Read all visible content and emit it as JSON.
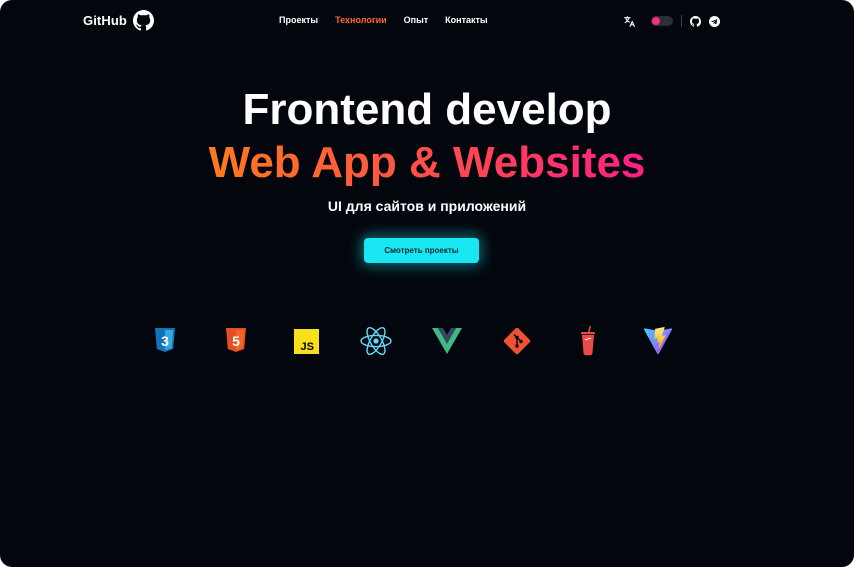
{
  "header": {
    "logo_text": "GitHub",
    "nav": [
      {
        "label": "Проекты",
        "active": false
      },
      {
        "label": "Технологии",
        "active": true
      },
      {
        "label": "Опыт",
        "active": false
      },
      {
        "label": "Контакты",
        "active": false
      }
    ],
    "theme_toggle": {
      "on": false
    },
    "icons": [
      "github-logo-icon",
      "translate-icon",
      "github-icon",
      "telegram-icon"
    ]
  },
  "hero": {
    "title": "Frontend develop",
    "gradient_title": "Web App & Websites",
    "subtitle": "UI для сайтов и приложений",
    "cta_label": "Смотреть проекты"
  },
  "tech_stack": [
    {
      "name": "css3-icon",
      "text": "3"
    },
    {
      "name": "html5-icon",
      "text": "5"
    },
    {
      "name": "javascript-icon",
      "text": "JS"
    },
    {
      "name": "react-icon"
    },
    {
      "name": "vue-icon"
    },
    {
      "name": "git-icon"
    },
    {
      "name": "gulp-icon"
    },
    {
      "name": "vite-icon"
    }
  ],
  "colors": {
    "background": "#03060d",
    "accent_orange": "#ff6a2b",
    "accent_pink": "#ff1f85",
    "cta": "#18e6f0"
  }
}
